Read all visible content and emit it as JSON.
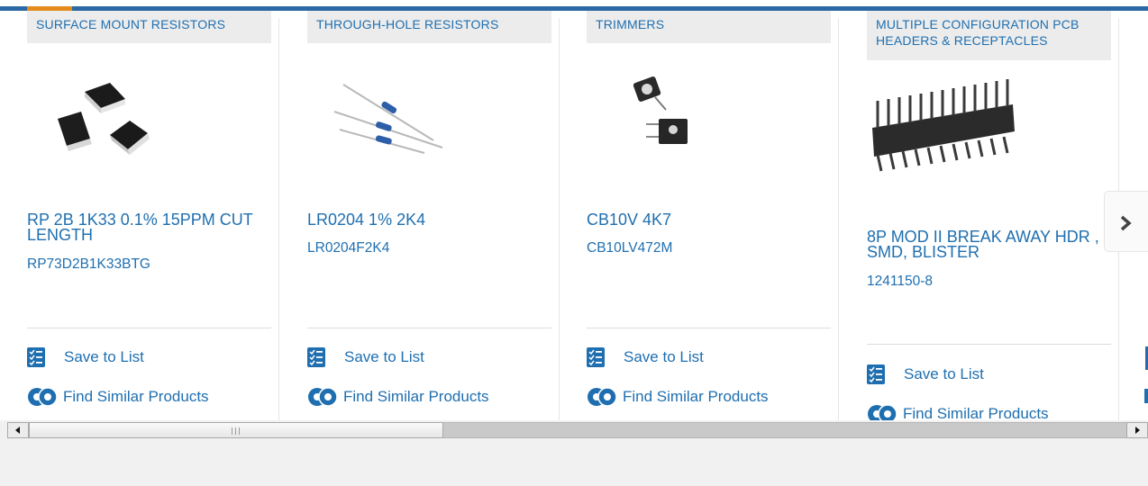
{
  "products": [
    {
      "category": "SURFACE MOUNT RESISTORS",
      "title": "RP 2B 1K33 0.1% 15PPM CUT LENGTH",
      "part_number": "RP73D2B1K33BTG",
      "image_icon": "smd-resistor-chips-image"
    },
    {
      "category": "THROUGH-HOLE RESISTORS",
      "title": "LR0204 1% 2K4",
      "part_number": "LR0204F2K4",
      "image_icon": "axial-resistors-image"
    },
    {
      "category": "TRIMMERS",
      "title": "CB10V 4K7",
      "part_number": "CB10LV472M",
      "image_icon": "trimmer-potentiometer-image"
    },
    {
      "category": "MULTIPLE CONFIGURATION PCB HEADERS & RECEPTACLES",
      "title": "8P MOD II BREAK AWAY HDR , SMD, BLISTER",
      "part_number": "1241150-8",
      "image_icon": "pin-header-image"
    }
  ],
  "actions": {
    "save_to_list": "Save to List",
    "find_similar": "Find Similar Products"
  },
  "colors": {
    "link": "#1f6fb0",
    "topbar_blue": "#2a69a3",
    "topbar_orange": "#e58b1c",
    "category_bg": "#ececec"
  },
  "icons": {
    "save": "checklist-icon",
    "similar": "gears-icon",
    "next": "chevron-right-icon",
    "scroll_left": "arrow-left-icon",
    "scroll_right": "arrow-right-icon"
  }
}
